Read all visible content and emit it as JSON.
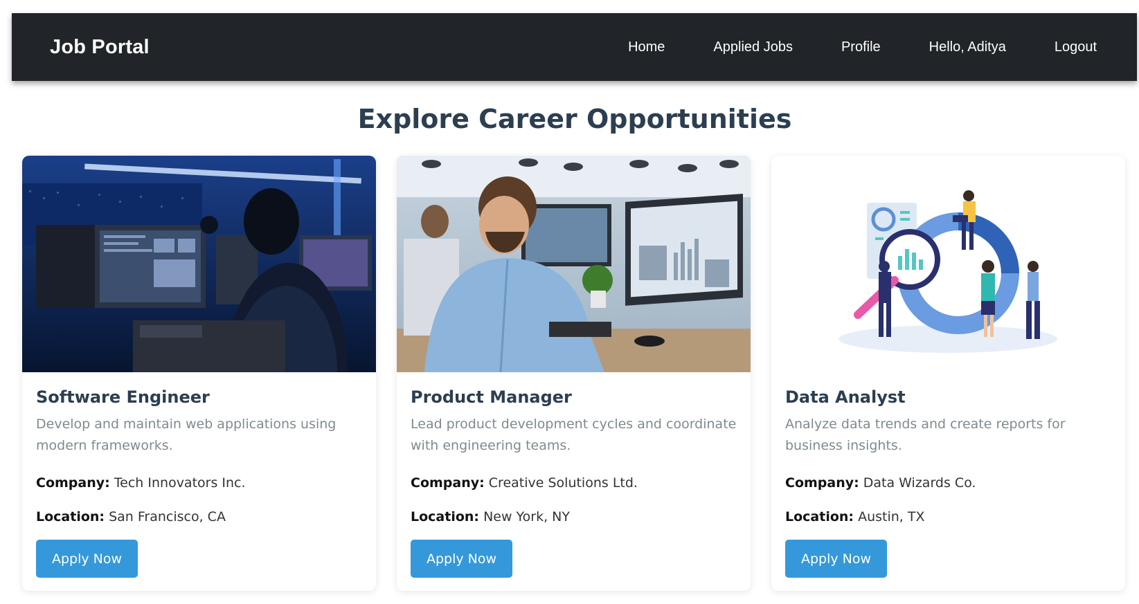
{
  "nav": {
    "brand": "Job Portal",
    "links": [
      "Home",
      "Applied Jobs",
      "Profile",
      "Hello, Aditya",
      "Logout"
    ]
  },
  "page_title": "Explore Career Opportunities",
  "labels": {
    "company": "Company:",
    "location": "Location:"
  },
  "jobs": [
    {
      "title": "Software Engineer",
      "description": "Develop and maintain web applications using modern frameworks.",
      "company": "Tech Innovators Inc.",
      "location": "San Francisco, CA",
      "apply_label": "Apply Now",
      "image": "photo-engineer-at-computer-server-room"
    },
    {
      "title": "Product Manager",
      "description": "Lead product development cycles and coordinate with engineering teams.",
      "company": "Creative Solutions Ltd.",
      "location": "New York, NY",
      "apply_label": "Apply Now",
      "image": "photo-man-at-desk-with-charts"
    },
    {
      "title": "Data Analyst",
      "description": "Analyze data trends and create reports for business insights.",
      "company": "Data Wizards Co.",
      "location": "Austin, TX",
      "apply_label": "Apply Now",
      "image": "illustration-data-analysis-team"
    }
  ],
  "colors": {
    "navbar": "#212428",
    "accent": "#3498db",
    "title": "#2c3e50",
    "muted": "#7f8a8f"
  }
}
